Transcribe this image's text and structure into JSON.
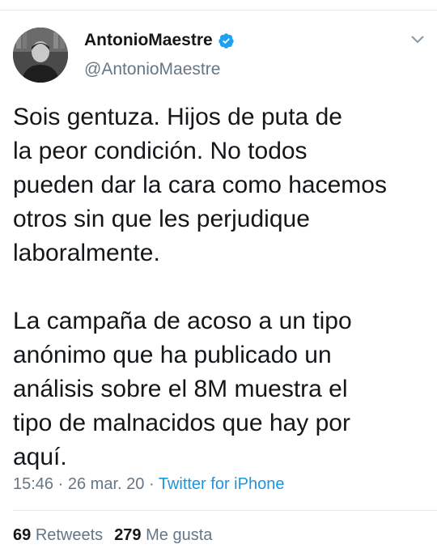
{
  "tweet": {
    "display_name": "AntonioMaestre",
    "handle": "@AntonioMaestre",
    "verified_icon": "verified-badge-icon",
    "menu_icon": "chevron-down-icon",
    "avatar_alt": "avatar",
    "paragraphs": [
      "Sois gentuza. Hijos de puta de\nla peor condición. No todos\npueden dar la cara como hacemos\notros sin que les perjudique\nlaboralmente.",
      "La campaña de acoso a un tipo\nanónimo que ha publicado un\nanálisis sobre el 8M muestra el\ntipo de malnacidos que hay por\naquí."
    ],
    "time": "15:46",
    "separator": "·",
    "date": "26 mar. 20",
    "source": "Twitter for iPhone"
  },
  "stats": {
    "retweets_count": "69",
    "retweets_label": "Retweets",
    "likes_count": "279",
    "likes_label": "Me gusta"
  },
  "colors": {
    "text": "#14171a",
    "secondary": "#657786",
    "link": "#1b95e0",
    "verified": "#1da1f2",
    "divider": "#e1e8ed"
  }
}
